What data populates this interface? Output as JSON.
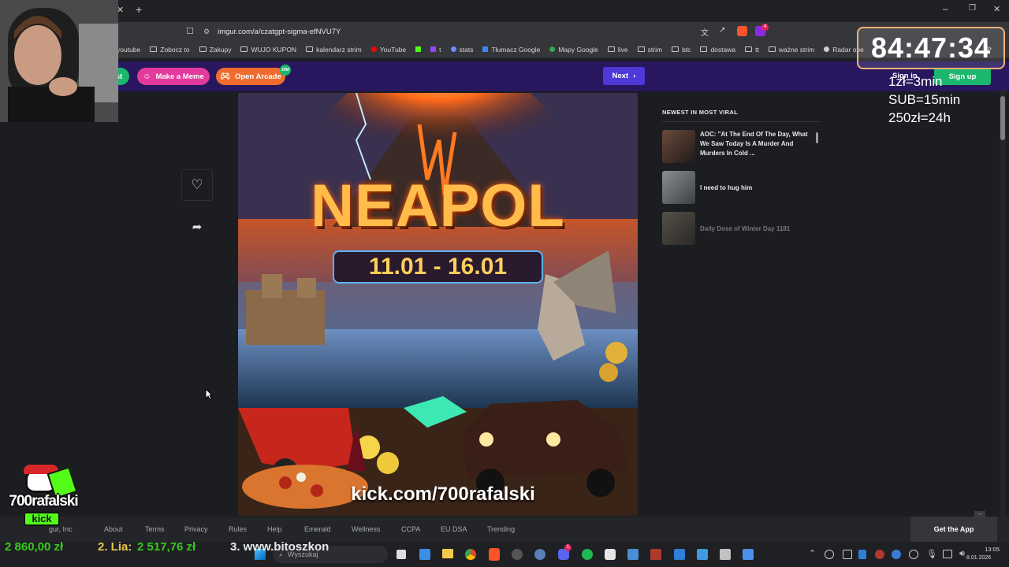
{
  "browser": {
    "url": "imgur.com/a/czatgpt-sigma-efNVU7Y",
    "bookmarks": [
      "youtube",
      "Zobocz to",
      "Zakupy",
      "WUJO KUPON",
      "kalendarz strim",
      "YouTube",
      "t",
      "stats",
      "Tłumacz Google",
      "Mapy Google",
      "live",
      "strim",
      "btc",
      "dostawa",
      "tt",
      "ważne strim",
      "Radar ope"
    ],
    "extension_badge": "4"
  },
  "imgur": {
    "buttons": {
      "partial_left": "st",
      "make_meme": "Make a Meme",
      "open_arcade": "Open Arcade",
      "arcade_badge": "20M",
      "next": "Next",
      "sign_in": "Sign in",
      "sign_up": "Sign up"
    },
    "poster": {
      "title": "NEAPOL",
      "dates": "11.01 - 16.01",
      "link": "kick.com/700rafalski"
    },
    "sidebar": {
      "heading": "NEWEST IN MOST VIRAL",
      "items": [
        {
          "title": "AOC: \"At The End Of The Day, What We Saw Today Is A Murder And Murders In Cold ..."
        },
        {
          "title": "I need to hug him"
        },
        {
          "title": "Daily Dose of Winter Day 1181"
        }
      ]
    },
    "footer": {
      "links": [
        "gur, Inc",
        "About",
        "Terms",
        "Privacy",
        "Rules",
        "Help",
        "Emerald",
        "Wellness",
        "CCPA",
        "EU DSA",
        "Trending"
      ],
      "get_app": "Get the App"
    }
  },
  "stream": {
    "timer": "84:47:34",
    "rules": [
      "1zł=3min",
      "SUB=15min",
      "250zł=24h"
    ],
    "logo_text": "700rafalski",
    "logo_sub": "kick",
    "ranking": [
      {
        "text": "2 860,00 zł",
        "color": "#3bdc1c"
      },
      {
        "text": "2. Lia: ",
        "color": "#ffd84a"
      },
      {
        "text": "2 517,76 zł",
        "color": "#3bdc1c"
      },
      {
        "text": "3. www.bitoszkon",
        "color": "#ffffff"
      }
    ]
  },
  "taskbar": {
    "search_placeholder": "Wyszukaj",
    "time": "13:05",
    "date": "8.01.2026",
    "notif_badge": "1"
  }
}
